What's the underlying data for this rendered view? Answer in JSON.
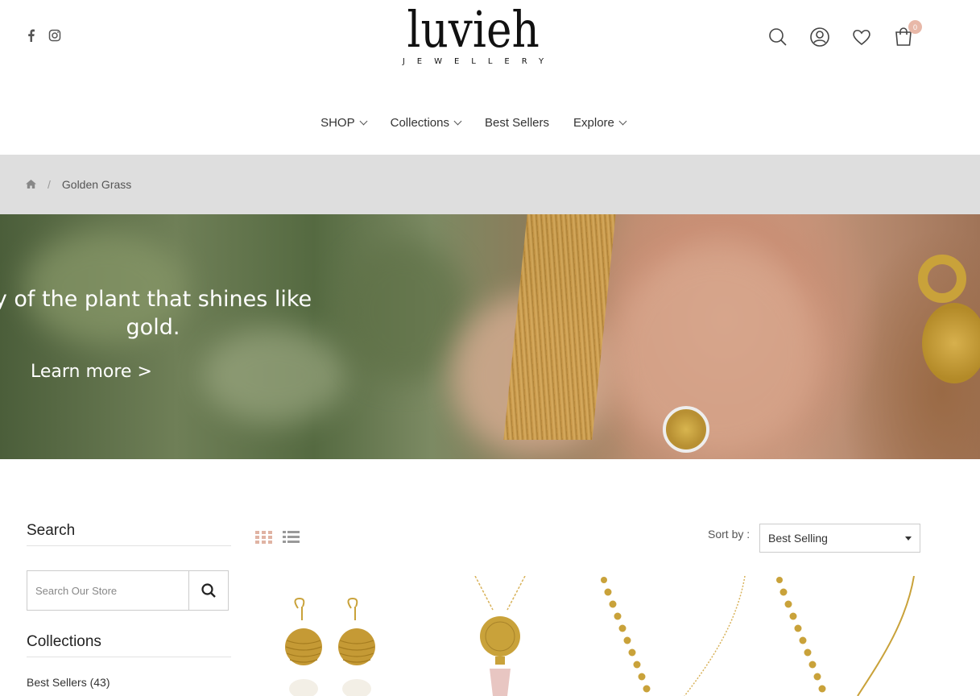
{
  "header": {
    "logo_main": "luvieh",
    "logo_sub": "JEWELLERY",
    "social": [
      "facebook-icon",
      "instagram-icon"
    ],
    "icons": [
      "search-icon",
      "account-icon",
      "wishlist-icon",
      "cart-icon"
    ],
    "cart_count": "0"
  },
  "nav": {
    "items": [
      {
        "label": "SHOP",
        "dropdown": true
      },
      {
        "label": "Collections",
        "dropdown": true
      },
      {
        "label": "Best Sellers",
        "dropdown": false
      },
      {
        "label": "Explore",
        "dropdown": true
      }
    ]
  },
  "breadcrumb": {
    "home_icon": "home-icon",
    "separator": "/",
    "current": "Golden Grass"
  },
  "hero": {
    "headline": "y of the plant that shines like gold.",
    "link": "Learn more >"
  },
  "sidebar": {
    "search_title": "Search",
    "search_placeholder": "Search Our Store",
    "collections_title": "Collections",
    "collections": [
      {
        "label": "Best Sellers (43)"
      }
    ]
  },
  "toolbar": {
    "sort_label": "Sort by :",
    "sort_value": "Best Selling"
  },
  "colors": {
    "accent": "#e8b8a8",
    "breadcrumb_bg": "#dedede",
    "gold": "#c9a23a"
  }
}
